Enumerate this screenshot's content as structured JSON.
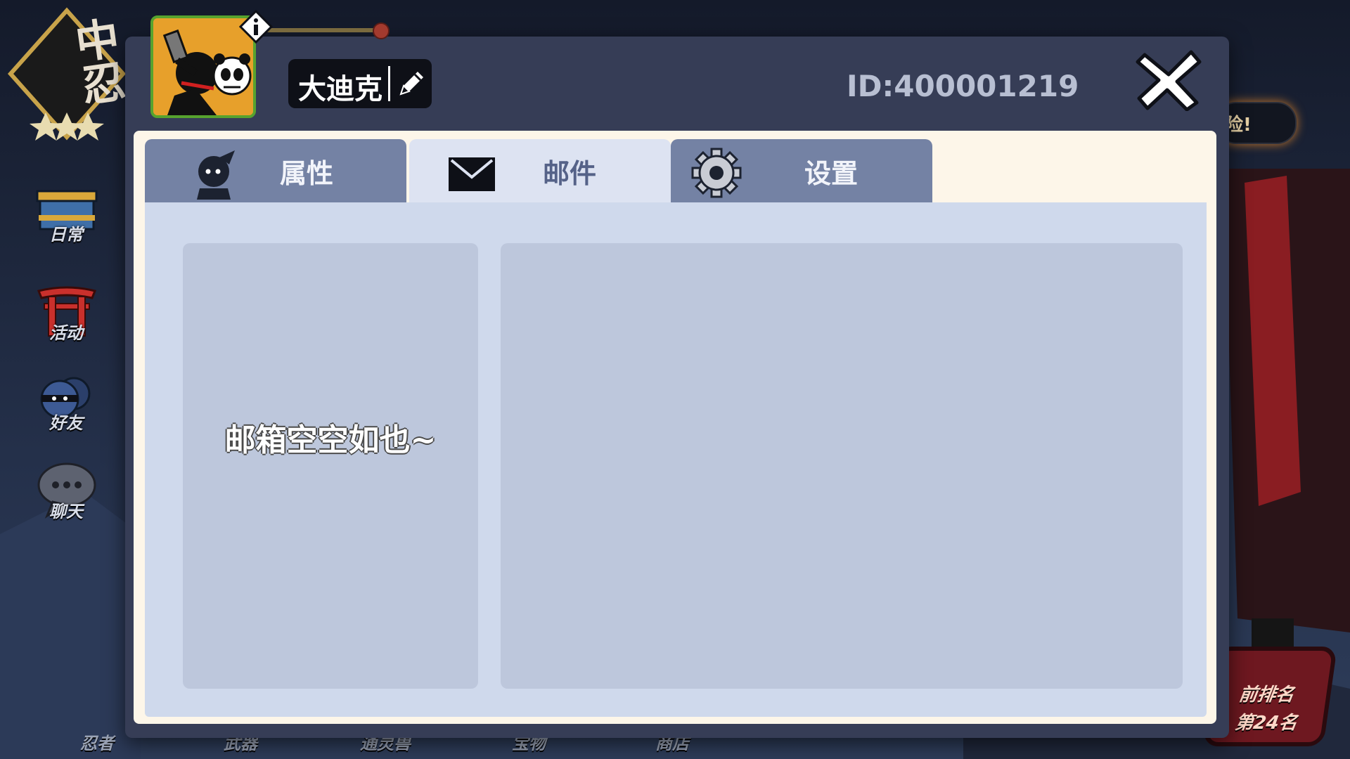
{
  "rank": {
    "text": "中忍"
  },
  "side_menu": [
    {
      "label": "日常",
      "icon": "gift-box-icon"
    },
    {
      "label": "活动",
      "icon": "torii-gate-icon"
    },
    {
      "label": "好友",
      "icon": "ninja-friend-icon"
    },
    {
      "label": "聊天",
      "icon": "chat-bubble-icon"
    }
  ],
  "background": {
    "adventure_text": "险!",
    "rank_line1": "前排名",
    "rank_line2": "第24名",
    "bottom_nav": [
      "忍者",
      "武器",
      "通灵兽",
      "宝物",
      "商店"
    ]
  },
  "profile": {
    "name": "大迪克",
    "id_text": "ID:400001219",
    "avatar": "ninja-panda-selfie-avatar",
    "info_icon": "info-icon",
    "edit_icon": "pencil-icon",
    "close_icon": "close-x-icon"
  },
  "tabs": [
    {
      "label": "属性",
      "icon": "ninja-head-icon",
      "active": false
    },
    {
      "label": "邮件",
      "icon": "envelope-icon",
      "active": true
    },
    {
      "label": "设置",
      "icon": "gear-icon",
      "active": false
    }
  ],
  "mail": {
    "empty_text": "邮箱空空如也~"
  },
  "colors": {
    "modal_frame": "#363d56",
    "panel_bg": "#fdf6e9",
    "tab_inactive": "#7482a4",
    "tab_active": "#dde3f2",
    "content_bg": "#cfd9ec",
    "box_bg": "#bdc7dc",
    "avatar_border": "#57a32e"
  }
}
